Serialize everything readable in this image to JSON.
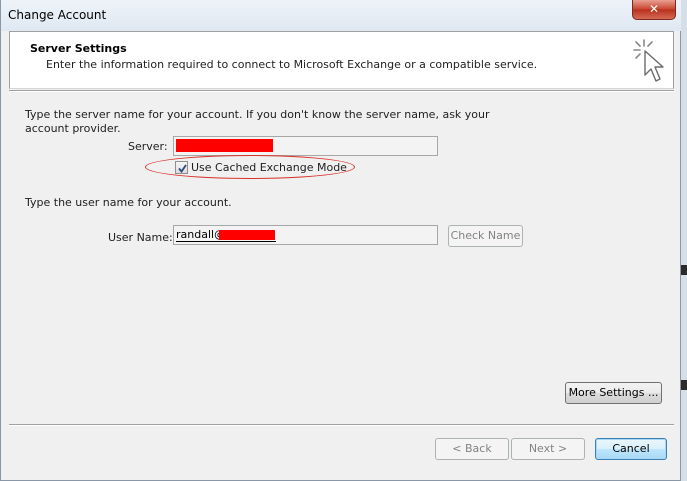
{
  "window": {
    "title": "Change Account",
    "close_glyph": "✕"
  },
  "header": {
    "title": "Server Settings",
    "subtitle": "Enter the information required to connect to Microsoft Exchange or a compatible service.",
    "icon": "wizard-cursor-icon"
  },
  "server_section": {
    "instructions_line1": "Type the server name for your account. If you don't know the server name, ask your",
    "instructions_line2": "account provider.",
    "server_label": "Server:",
    "server_value_redacted": true,
    "cached_mode_label": "Use Cached Exchange Mode",
    "cached_mode_checked": true
  },
  "user_section": {
    "instructions": "Type the user name for your account.",
    "user_label": "User Name:",
    "user_value_visible": "randall@",
    "check_name_label": "Check Name"
  },
  "buttons": {
    "more_settings": "More Settings ...",
    "back": "< Back",
    "next": "Next >",
    "cancel": "Cancel"
  },
  "colors": {
    "redaction": "#ff0000",
    "highlight_ellipse": "#d8312a",
    "header_bg": "#ffffff",
    "dialog_bg": "#f0f0f0"
  }
}
